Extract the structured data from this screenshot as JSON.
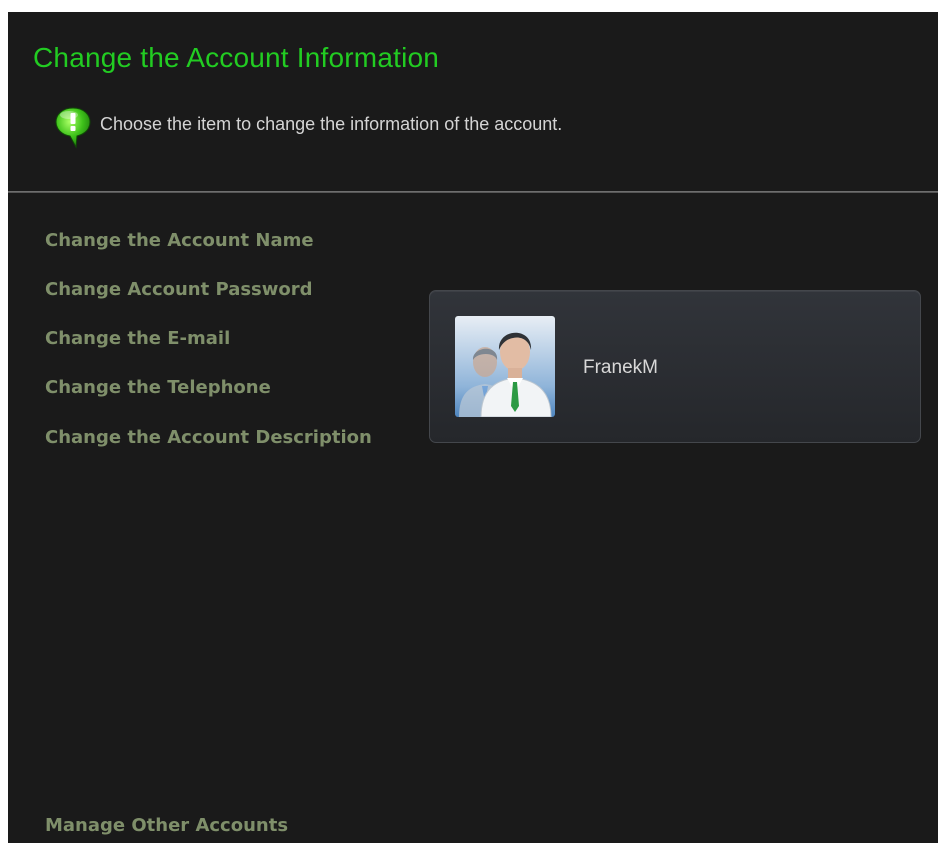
{
  "header": {
    "title": "Change the Account Information",
    "info_text": "Choose the item to change the information of the account.",
    "info_icon": "info-bubble-icon"
  },
  "menu": {
    "items": [
      {
        "label": "Change the Account Name"
      },
      {
        "label": "Change Account Password"
      },
      {
        "label": "Change the E-mail"
      },
      {
        "label": "Change the Telephone"
      },
      {
        "label": "Change the Account Description"
      }
    ]
  },
  "account": {
    "username": "FranekM",
    "avatar_icon": "user-accounts-icon"
  },
  "footer": {
    "manage_label": "Manage Other Accounts"
  },
  "colors": {
    "background": "#1a1a1a",
    "title": "#22cc22",
    "link": "#7f8f6a",
    "text": "#d4d4d4"
  }
}
